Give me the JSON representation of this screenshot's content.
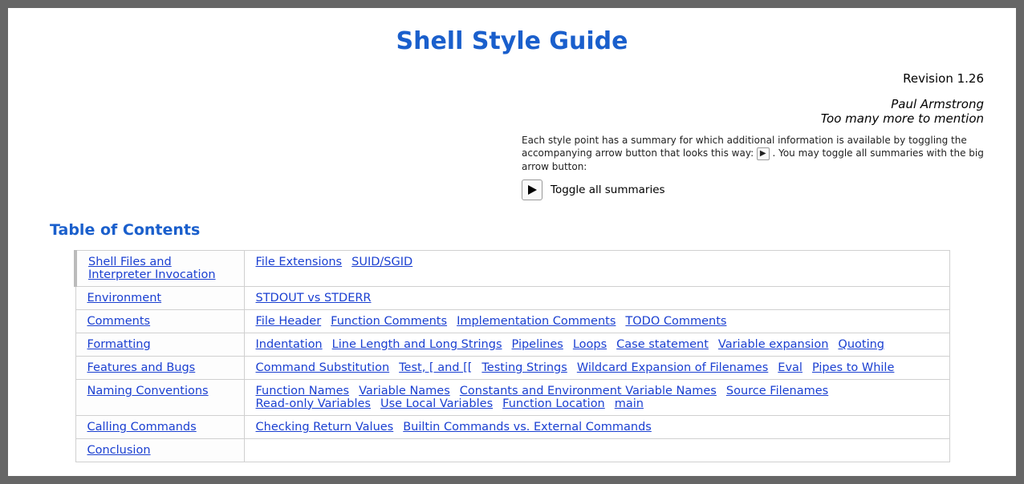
{
  "title": "Shell Style Guide",
  "revision_label": "Revision 1.26",
  "authors": {
    "line1": "Paul Armstrong",
    "line2": "Too many more to mention"
  },
  "intro": {
    "part1": "Each style point has a summary for which additional information is available by toggling the accompanying arrow button that looks this way: ",
    "arrow_glyph": "▶",
    "part2": " . You may toggle all summaries with the big arrow button:"
  },
  "toggle_label": "Toggle all summaries",
  "toc_heading": "Table of Contents",
  "toc": [
    {
      "category": "Shell Files and Interpreter Invocation",
      "items": [
        "File Extensions",
        "SUID/SGID"
      ]
    },
    {
      "category": "Environment",
      "items": [
        "STDOUT vs STDERR"
      ]
    },
    {
      "category": "Comments",
      "items": [
        "File Header",
        "Function Comments",
        "Implementation Comments",
        "TODO Comments"
      ]
    },
    {
      "category": "Formatting",
      "items": [
        "Indentation",
        "Line Length and Long Strings",
        "Pipelines",
        "Loops",
        "Case statement",
        "Variable expansion",
        "Quoting"
      ]
    },
    {
      "category": "Features and Bugs",
      "items": [
        "Command Substitution",
        "Test, [ and [[",
        "Testing Strings",
        "Wildcard Expansion of Filenames",
        "Eval",
        "Pipes to While"
      ]
    },
    {
      "category": "Naming Conventions",
      "items": [
        "Function Names",
        "Variable Names",
        "Constants and Environment Variable Names",
        "Source Filenames",
        "Read-only Variables",
        "Use Local Variables",
        "Function Location",
        "main"
      ]
    },
    {
      "category": "Calling Commands",
      "items": [
        "Checking Return Values",
        "Builtin Commands vs. External Commands"
      ]
    },
    {
      "category": "Conclusion",
      "items": []
    }
  ]
}
